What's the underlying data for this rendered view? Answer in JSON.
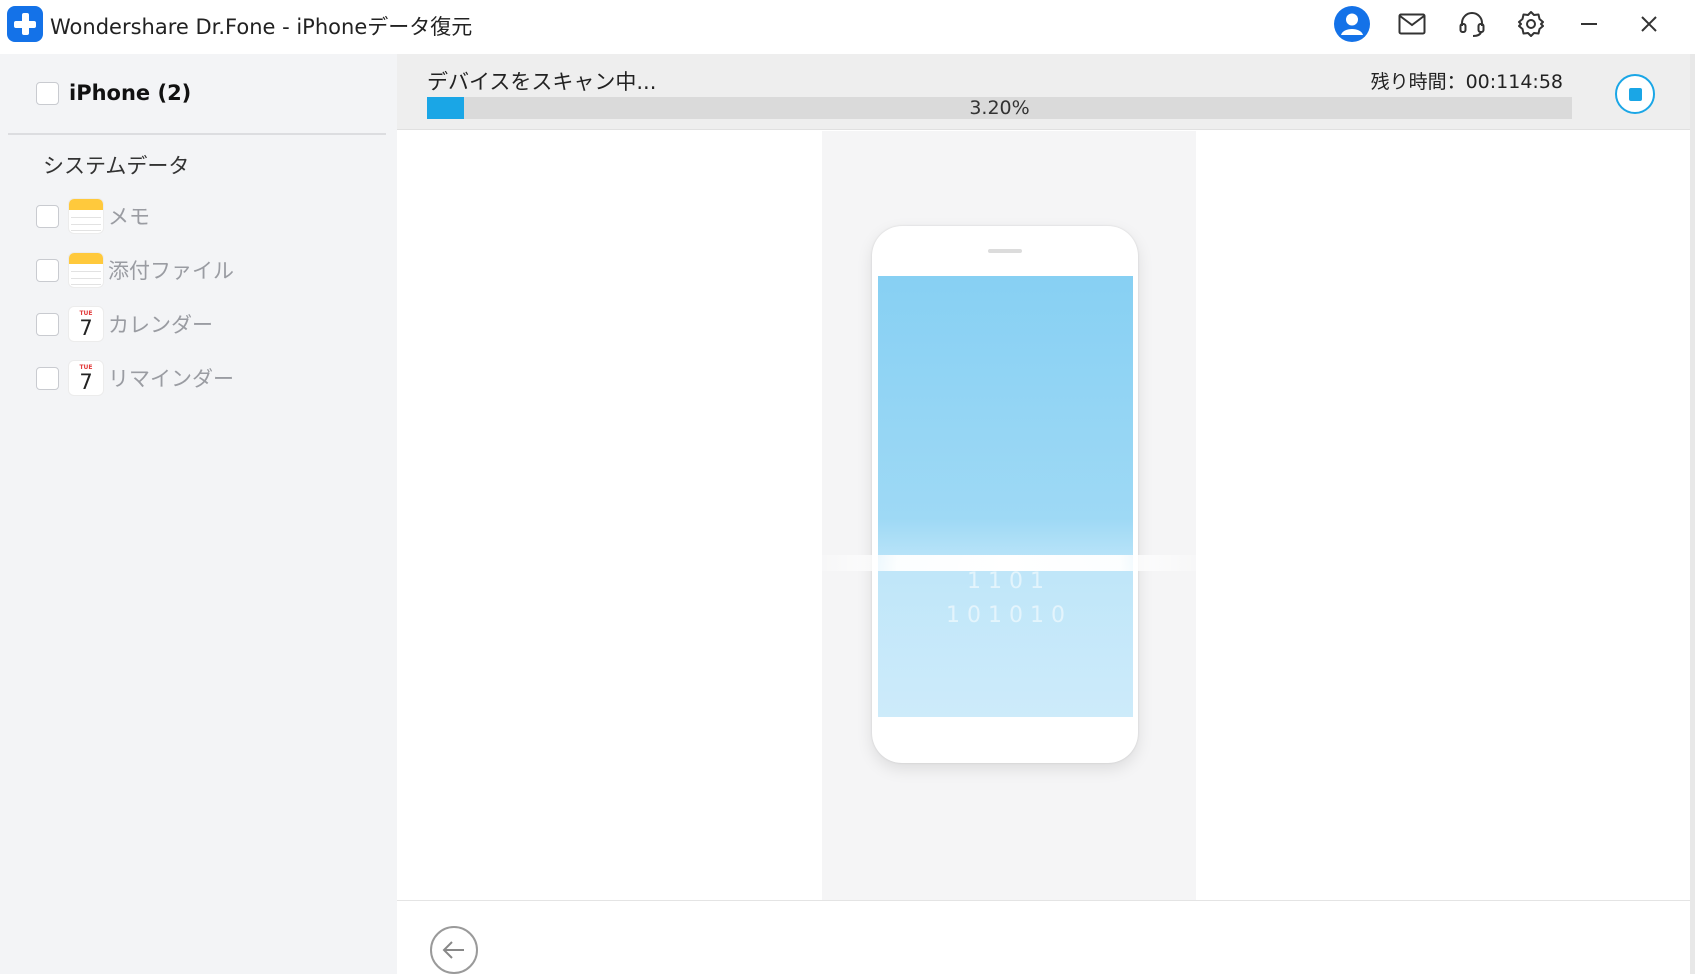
{
  "window": {
    "title": "Wondershare Dr.Fone - iPhoneデータ復元"
  },
  "titlebar": {
    "icons": [
      "account-icon",
      "mail-icon",
      "headset-icon",
      "gear-icon",
      "minimize-icon",
      "close-icon"
    ]
  },
  "sidebar": {
    "device": {
      "label": "iPhone (2)"
    },
    "section_title": "システムデータ",
    "items": [
      {
        "label": "メモ",
        "icon": "notes-icon"
      },
      {
        "label": "添付ファイル",
        "icon": "notes-icon"
      },
      {
        "label": "カレンダー",
        "icon": "calendar-icon",
        "month": "TUE",
        "day": "7"
      },
      {
        "label": "リマインダー",
        "icon": "calendar-icon",
        "month": "TUE",
        "day": "7"
      }
    ]
  },
  "scan": {
    "status": "デバイスをスキャン中...",
    "time_remaining": "残り時間：00:114:58",
    "progress_percent": 3.2,
    "progress_label": "3.20%"
  },
  "animation": {
    "binary_row_1": "1   1  0  1",
    "binary_row_2": "1 0 1  0  1   0"
  },
  "colors": {
    "accent": "#1aa6e6",
    "brand": "#1472e8",
    "sidebar_bg": "#f3f4f6",
    "phone_screen": "#87d0f3"
  }
}
